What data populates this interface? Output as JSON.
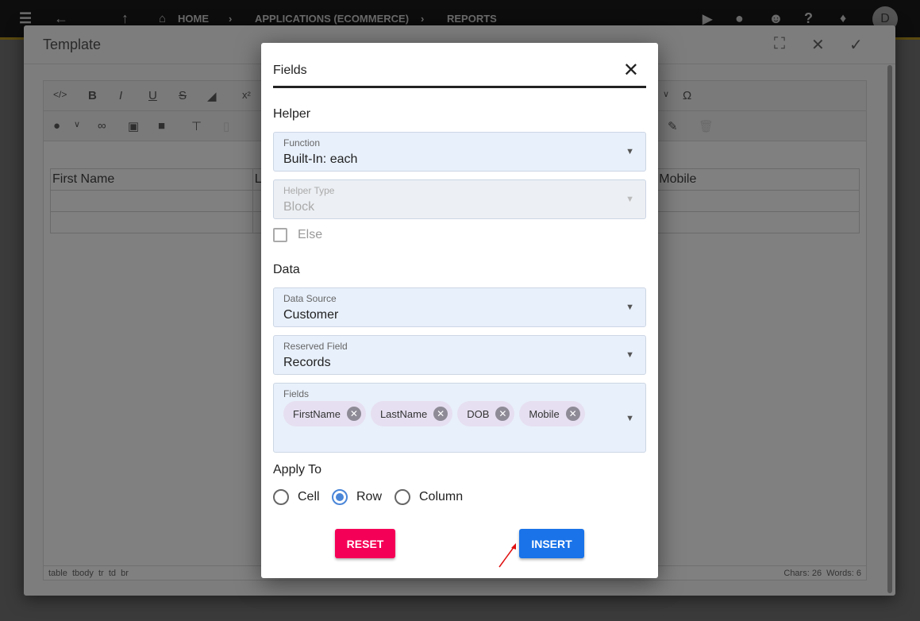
{
  "topbar": {
    "breadcrumbs": [
      "HOME",
      "APPLICATIONS (ECOMMERCE)",
      "REPORTS"
    ],
    "avatar": "D"
  },
  "template": {
    "title": "Template",
    "table_headers": [
      "First Name",
      "L",
      "",
      "Mobile"
    ],
    "status_path": "table  tbody  tr  td  br",
    "status_counts": "Chars: 26  Words: 6"
  },
  "modal": {
    "title": "Fields",
    "helper_heading": "Helper",
    "function": {
      "label": "Function",
      "value": "Built-In: each"
    },
    "helper_type": {
      "label": "Helper Type",
      "value": "Block"
    },
    "else_label": "Else",
    "data_heading": "Data",
    "data_source": {
      "label": "Data Source",
      "value": "Customer"
    },
    "reserved_field": {
      "label": "Reserved Field",
      "value": "Records"
    },
    "fields": {
      "label": "Fields",
      "chips": [
        "FirstName",
        "LastName",
        "DOB",
        "Mobile"
      ]
    },
    "apply_to": {
      "label": "Apply To",
      "options": [
        "Cell",
        "Row",
        "Column"
      ],
      "selected": "Row"
    },
    "reset_label": "RESET",
    "insert_label": "INSERT"
  },
  "colors": {
    "reset": "#f50057",
    "insert": "#1a73e8",
    "radio": "#4a86d8"
  }
}
